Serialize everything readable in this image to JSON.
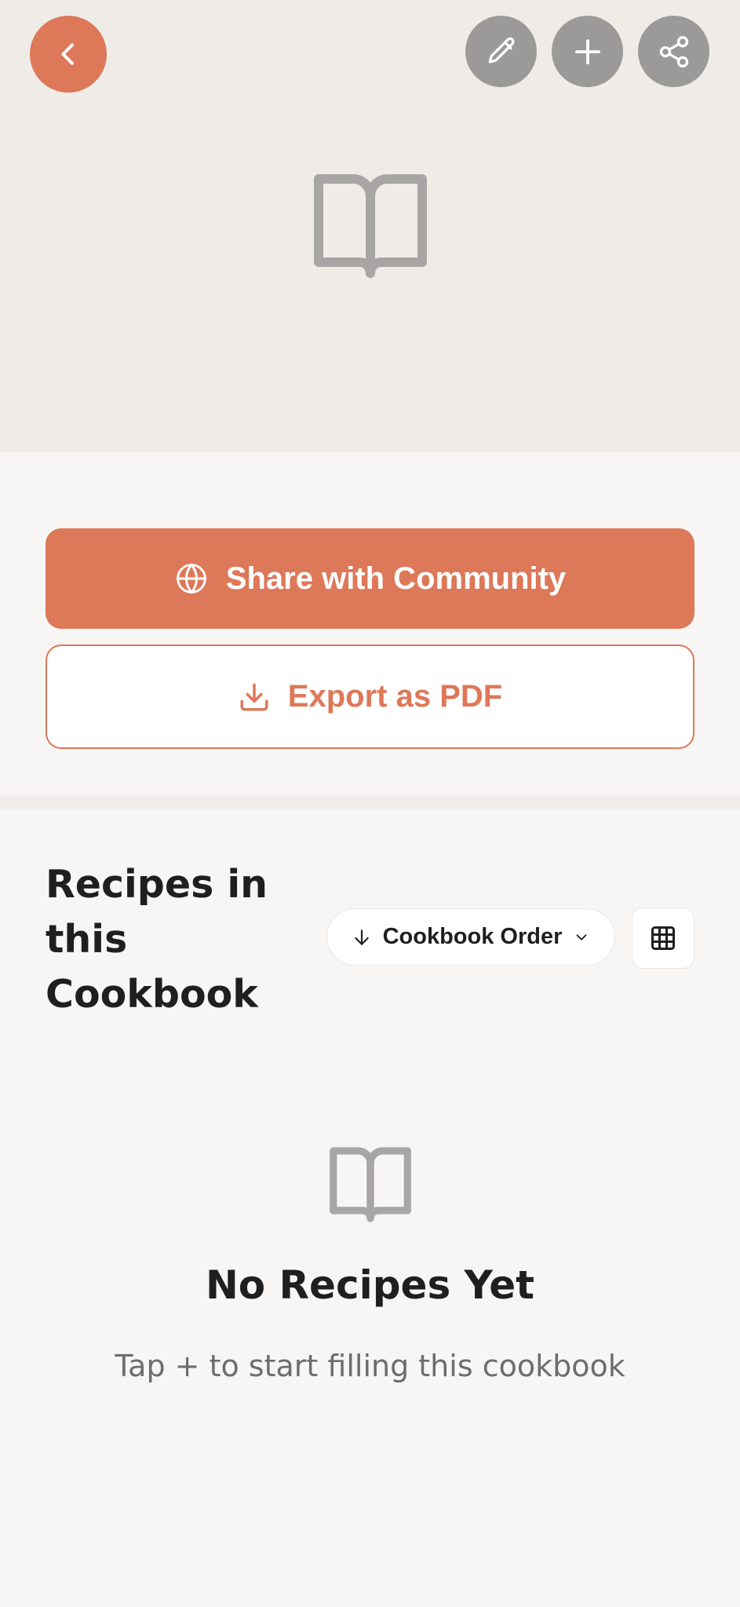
{
  "header": {
    "back_icon": "chevron-left-icon",
    "edit_icon": "pencil-icon",
    "add_icon": "plus-icon",
    "share_icon": "share-icon",
    "cover_icon": "open-book-icon"
  },
  "actions": {
    "share_label": "Share with Community",
    "share_icon": "globe-icon",
    "export_label": "Export as PDF",
    "export_icon": "download-icon"
  },
  "recipes": {
    "title": "Recipes in this Cookbook",
    "sort_label": "Cookbook Order",
    "sort_icon": "arrow-down-icon",
    "dropdown_icon": "chevron-down-icon",
    "view_icon": "grid-icon"
  },
  "empty_state": {
    "icon": "open-book-icon",
    "title": "No Recipes Yet",
    "subtitle": "Tap + to start filling this cookbook"
  },
  "colors": {
    "accent": "#dd7858",
    "cover_bg": "#efece8",
    "page_bg": "#f8f6f4",
    "header_btn_bg": "#9c9a98"
  }
}
